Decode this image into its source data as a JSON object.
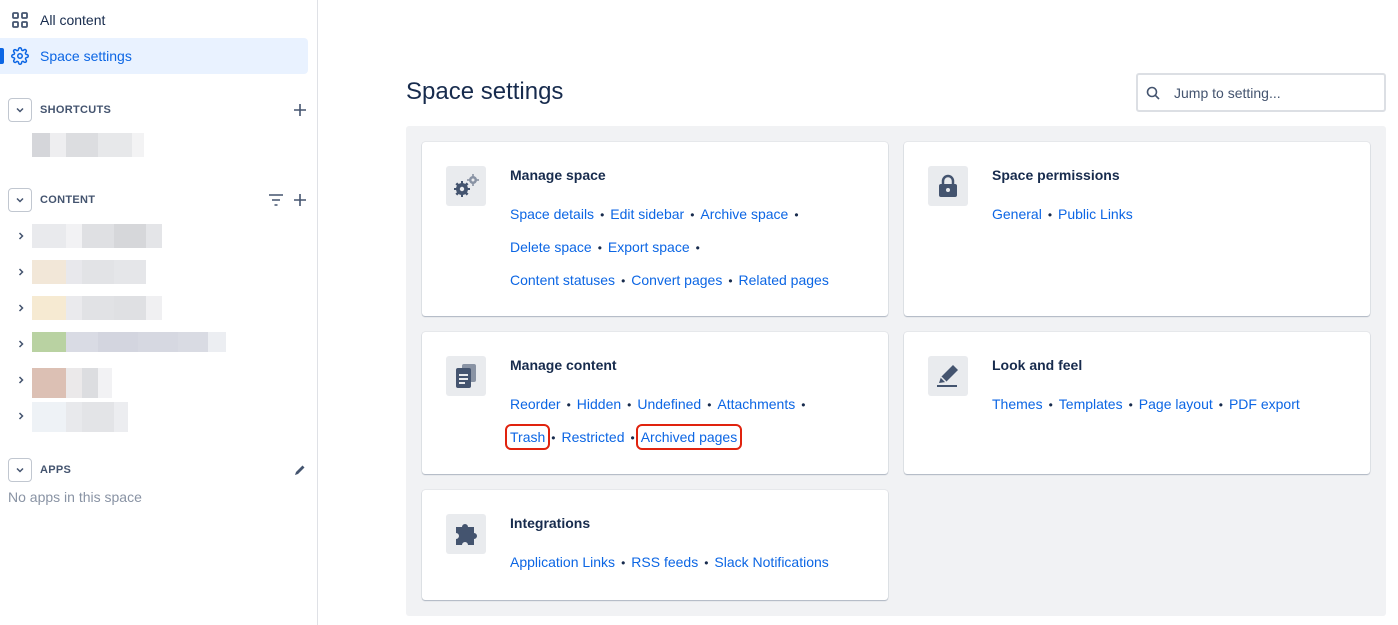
{
  "sidebar": {
    "all_content": "All content",
    "space_settings": "Space settings",
    "shortcuts_title": "SHORTCUTS",
    "content_title": "CONTENT",
    "apps_title": "APPS",
    "no_apps": "No apps in this space",
    "active_color": "#0c66e4"
  },
  "header": {
    "title": "Space settings",
    "search_placeholder": "Jump to setting..."
  },
  "cards": {
    "manage_space": {
      "title": "Manage space",
      "icon": "gears-icon",
      "links": [
        "Space details",
        "Edit sidebar",
        "Archive space",
        "Delete space",
        "Export space",
        "Content statuses",
        "Convert pages",
        "Related pages"
      ]
    },
    "space_permissions": {
      "title": "Space permissions",
      "icon": "lock-icon",
      "links": [
        "General",
        "Public Links"
      ]
    },
    "manage_content": {
      "title": "Manage content",
      "icon": "documents-icon",
      "links": [
        "Reorder",
        "Hidden",
        "Undefined",
        "Attachments",
        "Trash",
        "Restricted",
        "Archived pages"
      ]
    },
    "look_and_feel": {
      "title": "Look and feel",
      "icon": "pencil-icon",
      "links": [
        "Themes",
        "Templates",
        "Page layout",
        "PDF export"
      ]
    },
    "integrations": {
      "title": "Integrations",
      "icon": "puzzle-icon",
      "links": [
        "Application Links",
        "RSS feeds",
        "Slack Notifications"
      ]
    }
  },
  "colors": {
    "link": "#0c66e4",
    "highlight": "#e0230e",
    "panel_bg": "#f1f2f4"
  }
}
